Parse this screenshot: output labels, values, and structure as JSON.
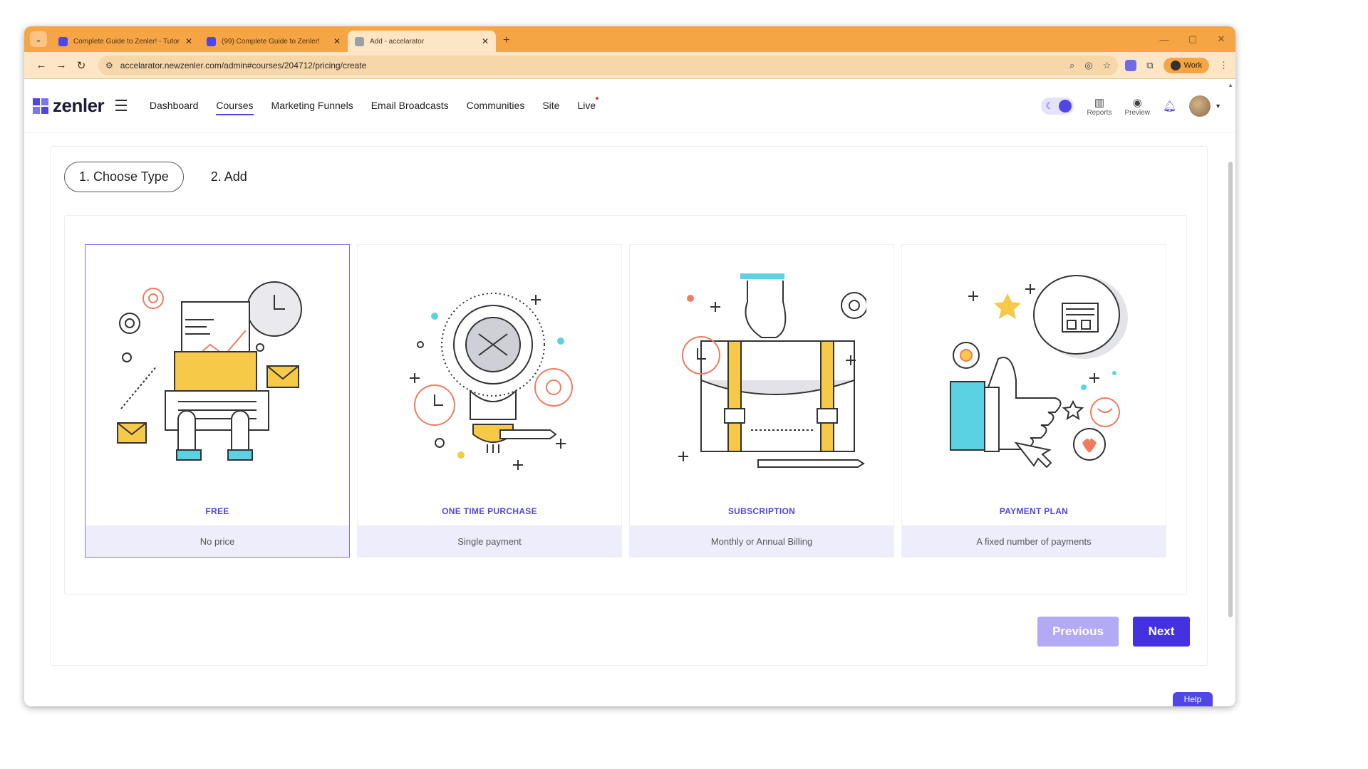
{
  "browser": {
    "tabs": [
      {
        "title": "Complete Guide to Zenler! - Tutor"
      },
      {
        "title": "(99) Complete Guide to Zenler!"
      },
      {
        "title": "Add - accelarator"
      }
    ],
    "url": "accelarator.newzenler.com/admin#courses/204712/pricing/create",
    "profile_label": "Work"
  },
  "app": {
    "logo_text": "zenler",
    "menu": [
      "Dashboard",
      "Courses",
      "Marketing Funnels",
      "Email Broadcasts",
      "Communities",
      "Site",
      "Live"
    ],
    "active_menu": "Courses",
    "reports_label": "Reports",
    "preview_label": "Preview"
  },
  "steps": {
    "step1": "1. Choose Type",
    "step2": "2. Add"
  },
  "cards": [
    {
      "label": "FREE",
      "sub": "No price"
    },
    {
      "label": "ONE TIME PURCHASE",
      "sub": "Single payment"
    },
    {
      "label": "SUBSCRIPTION",
      "sub": "Monthly or Annual Billing"
    },
    {
      "label": "PAYMENT PLAN",
      "sub": "A fixed number of payments"
    }
  ],
  "buttons": {
    "previous": "Previous",
    "next": "Next"
  },
  "help_label": "Help",
  "colors": {
    "accent": "#4f46e5",
    "browser_frame": "#f6a545",
    "illustration_yellow": "#f7c948",
    "illustration_cyan": "#5ad2e4",
    "illustration_coral": "#f07b5f"
  }
}
